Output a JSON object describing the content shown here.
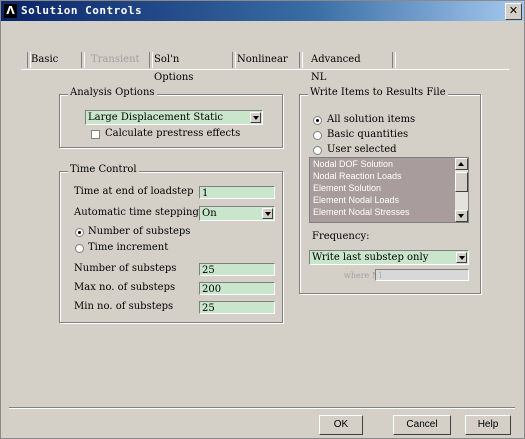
{
  "window": {
    "title": "Solution Controls",
    "app_icon_glyph": "Λ",
    "close_glyph": "✕"
  },
  "tabs": [
    {
      "label": "Basic",
      "enabled": true
    },
    {
      "label": "Transient",
      "enabled": false
    },
    {
      "label": "Sol'n Options",
      "enabled": true
    },
    {
      "label": "Nonlinear",
      "enabled": true
    },
    {
      "label": "Advanced NL",
      "enabled": true
    }
  ],
  "analysis_options": {
    "group_label": "Analysis Options",
    "type_value": "Large Displacement Static",
    "prestress_label": "Calculate prestress effects",
    "prestress_checked": false
  },
  "time_control": {
    "group_label": "Time Control",
    "time_end_label": "Time at end of loadstep",
    "time_end_value": "1",
    "auto_step_label": "Automatic time stepping",
    "auto_step_value": "On",
    "radio_substeps_label": "Number of substeps",
    "radio_increment_label": "Time increment",
    "substeps_label": "Number of substeps",
    "substeps_value": "25",
    "max_substeps_label": "Max no. of substeps",
    "max_substeps_value": "200",
    "min_substeps_label": "Min no. of substeps",
    "min_substeps_value": "25"
  },
  "write_items": {
    "group_label": "Write Items to Results File",
    "radio_all_label": "All solution items",
    "radio_basic_label": "Basic quantities",
    "radio_user_label": "User selected",
    "list_items": [
      "Nodal DOF Solution",
      "Nodal Reaction Loads",
      "Element Solution",
      "Element Nodal Loads",
      "Element Nodal Stresses"
    ],
    "frequency_label": "Frequency:",
    "frequency_value": "Write last substep only",
    "where_label": "where N =",
    "where_value": "1"
  },
  "buttons": {
    "ok": "OK",
    "cancel": "Cancel",
    "help": "Help"
  },
  "colors": {
    "field_bg": "#c9e6cc",
    "list_bg": "#a99c9c",
    "title_start": "#0a246a",
    "title_end": "#a6caf0"
  }
}
